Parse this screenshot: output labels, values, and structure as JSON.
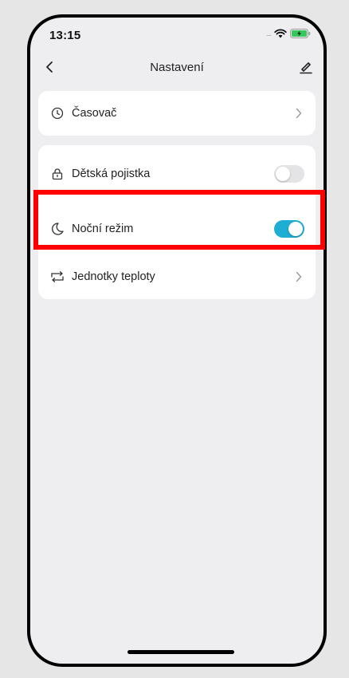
{
  "status_bar": {
    "time": "13:15",
    "signal_dots": "....",
    "icons": [
      "wifi-icon",
      "battery-charging-icon"
    ],
    "battery_color": "#34c759"
  },
  "nav": {
    "title": "Nastavení",
    "back_icon": "chevron-left-icon",
    "edit_icon": "edit-pencil-icon"
  },
  "sections": [
    {
      "items": [
        {
          "label": "Časovač",
          "icon": "clock-icon",
          "control": "chevron"
        }
      ]
    },
    {
      "items": [
        {
          "label": "Dětská pojistka",
          "icon": "lock-icon",
          "control": "toggle",
          "on": false
        },
        {
          "label": "Noční režim",
          "icon": "moon-icon",
          "control": "toggle",
          "on": true
        },
        {
          "label": "Jednotky teploty",
          "icon": "swap-icon",
          "control": "chevron"
        }
      ]
    }
  ],
  "colors": {
    "toggle_on": "#1eaed3",
    "toggle_off": "#e4e4e6",
    "highlight": "#ff0000",
    "background": "#eeeef0"
  }
}
